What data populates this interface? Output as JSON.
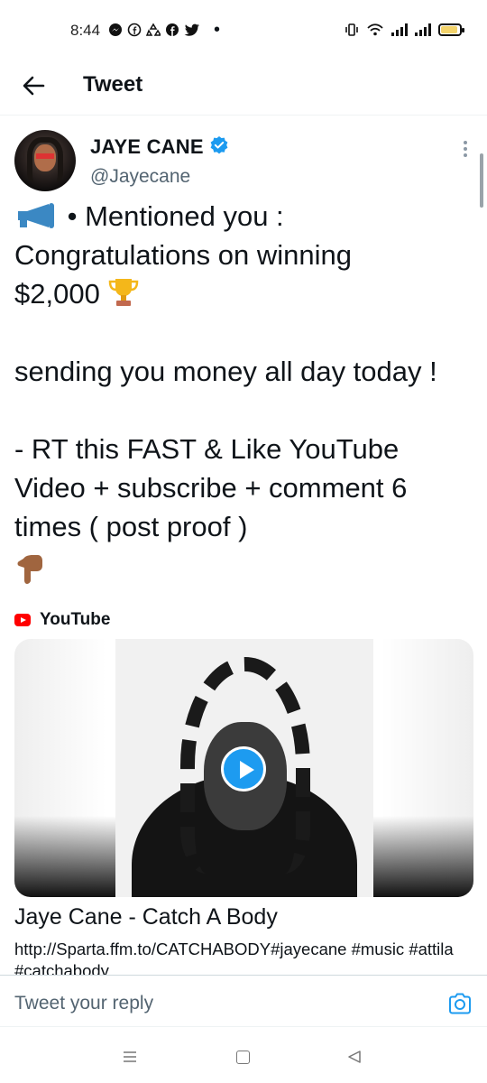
{
  "status_bar": {
    "time": "8:44",
    "left_icons": [
      "messenger-icon",
      "facebook-icon",
      "recycle-icon",
      "facebook-icon",
      "twitter-icon"
    ],
    "dot": "•",
    "battery_level": 0.9,
    "battery_color": "#f3d36b"
  },
  "header": {
    "title": "Tweet",
    "back_icon": "arrow-left-icon"
  },
  "tweet": {
    "display_name": "JAYE CANE",
    "verified": true,
    "handle": "@Jayecane",
    "line1": " • Mentioned you :",
    "line2": "Congratulations on winning",
    "line3": "$2,000 ",
    "line4": "sending you money all day today !",
    "line5": "- RT this FAST & Like YouTube",
    "line6": "Video + subscribe + comment 6",
    "line7": "times ( post proof )",
    "emojis": [
      "megaphone-emoji",
      "trophy-emoji",
      "pointing-down-emoji"
    ]
  },
  "card": {
    "source": "YouTube",
    "title": "Jaye Cane - Catch A Body",
    "description": "http://Sparta.ffm.to/CATCHABODY#jayecane #music #attila #catchabody"
  },
  "reply": {
    "placeholder": "Tweet your reply"
  },
  "colors": {
    "accent": "#1d9bf0",
    "youtube_red": "#ff0000",
    "text_secondary": "#536471"
  }
}
